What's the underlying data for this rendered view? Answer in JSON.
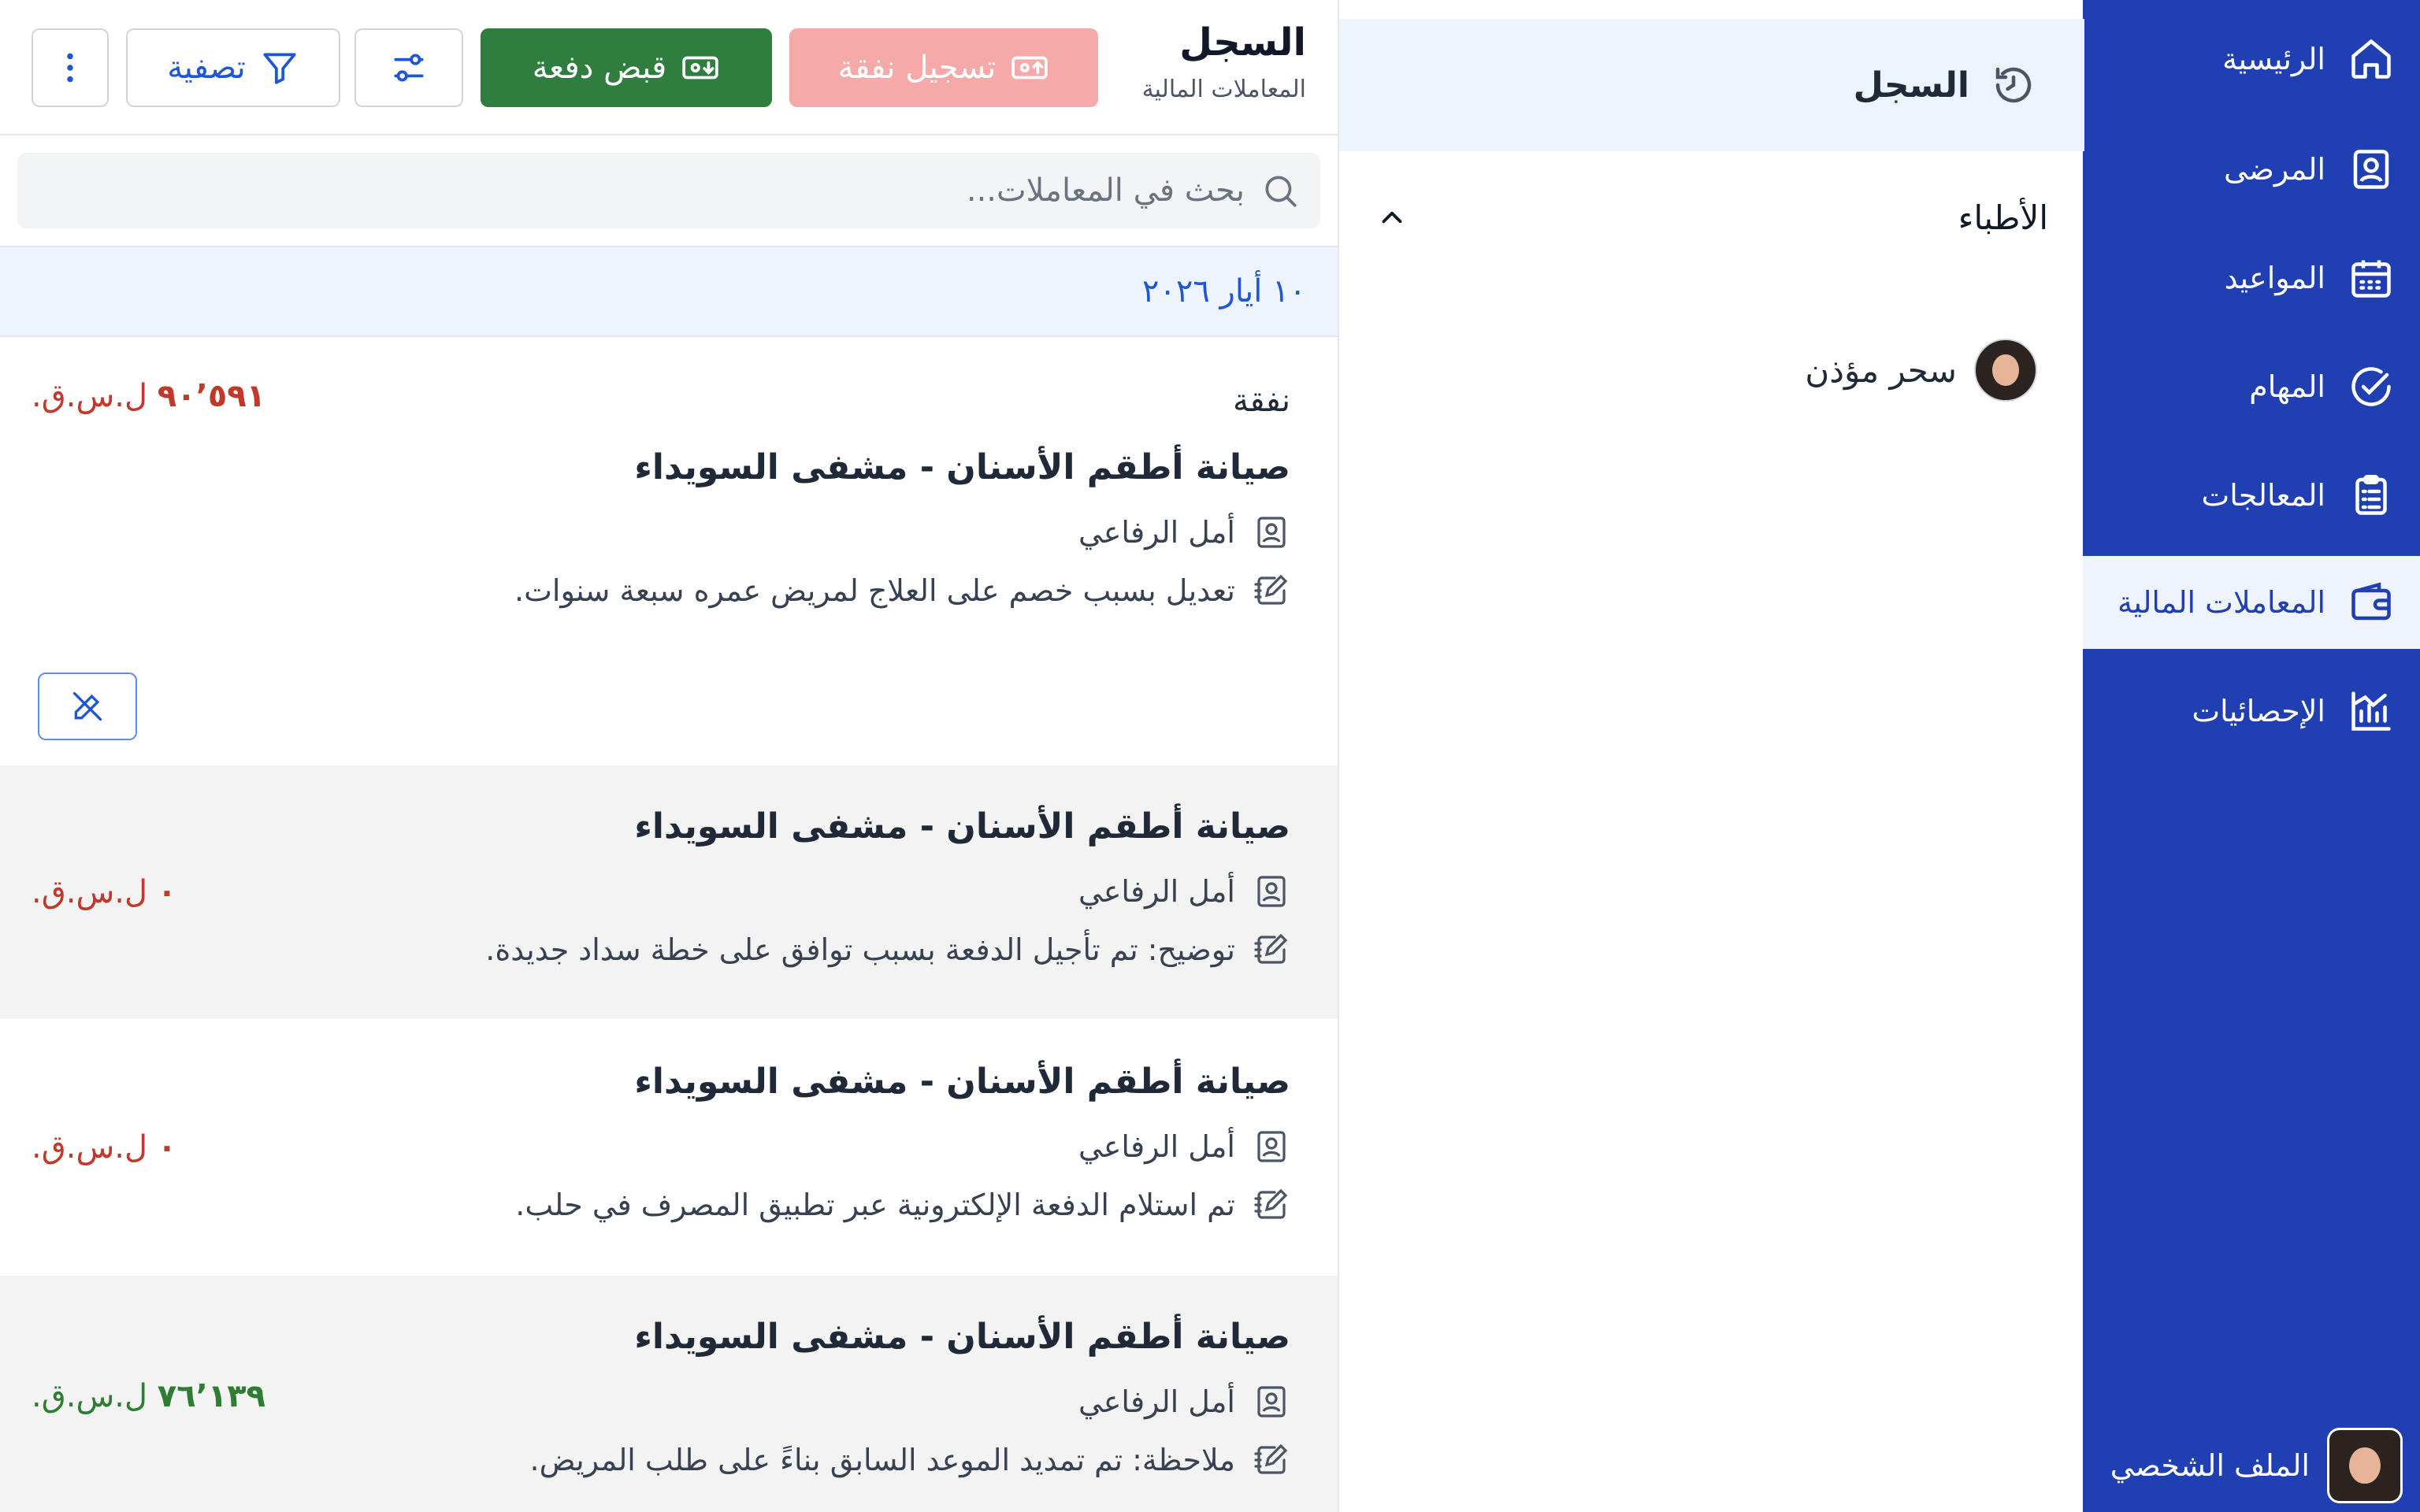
{
  "nav": {
    "items": [
      {
        "label": "الرئيسية",
        "icon": "home-icon"
      },
      {
        "label": "المرضى",
        "icon": "patient-card-icon"
      },
      {
        "label": "المواعيد",
        "icon": "calendar-icon"
      },
      {
        "label": "المهام",
        "icon": "check-circle-icon"
      },
      {
        "label": "المعالجات",
        "icon": "clipboard-list-icon"
      },
      {
        "label": "المعاملات المالية",
        "icon": "wallet-icon",
        "active": true
      },
      {
        "label": "الإحصائيات",
        "icon": "chart-icon"
      }
    ],
    "profile_label": "الملف الشخصي"
  },
  "middle": {
    "title": "السجل",
    "group_label": "الأطباء",
    "doctor_name": "سحر مؤذن"
  },
  "toolbar": {
    "title": "السجل",
    "subtitle": "المعاملات المالية",
    "expense_label": "تسجيل نفقة",
    "payment_label": "قبض دفعة",
    "filter_label": "تصفية"
  },
  "search": {
    "placeholder": "بحث في المعاملات..."
  },
  "date_header": "١٠ أيار ٢٠٢٦",
  "currency": "ل.س.ق.",
  "colors": {
    "nav_bg": "#1f3fb2",
    "active_bg": "#eef3fe",
    "accent": "#1f56d6",
    "payment_green": "#2f7d3f",
    "expense_pink": "#f5a9a9",
    "negative": "#c0392b",
    "positive": "#2e7d32"
  },
  "transactions": [
    {
      "type": "نفقة",
      "title": "صيانة أطقم الأسنان - مشفى السويداء",
      "patient": "أمل الرفاعي",
      "note": "تعديل بسبب خصم على العلاج لمريض عمره سبعة سنوات.",
      "amount": "٩٠٬٥٩١",
      "sign": "neg"
    },
    {
      "type": "",
      "title": "صيانة أطقم الأسنان - مشفى السويداء",
      "patient": "أمل الرفاعي",
      "note": "توضيح: تم تأجيل الدفعة بسبب توافق على خطة سداد جديدة.",
      "amount": "٠",
      "sign": "neg"
    },
    {
      "type": "",
      "title": "صيانة أطقم الأسنان - مشفى السويداء",
      "patient": "أمل الرفاعي",
      "note": "تم استلام الدفعة الإلكترونية عبر تطبيق المصرف في حلب.",
      "amount": "٠",
      "sign": "neg"
    },
    {
      "type": "",
      "title": "صيانة أطقم الأسنان - مشفى السويداء",
      "patient": "أمل الرفاعي",
      "note": "ملاحظة: تم تمديد الموعد السابق بناءً على طلب المريض.",
      "amount": "٧٦٬١٣٩",
      "sign": "pos"
    }
  ]
}
